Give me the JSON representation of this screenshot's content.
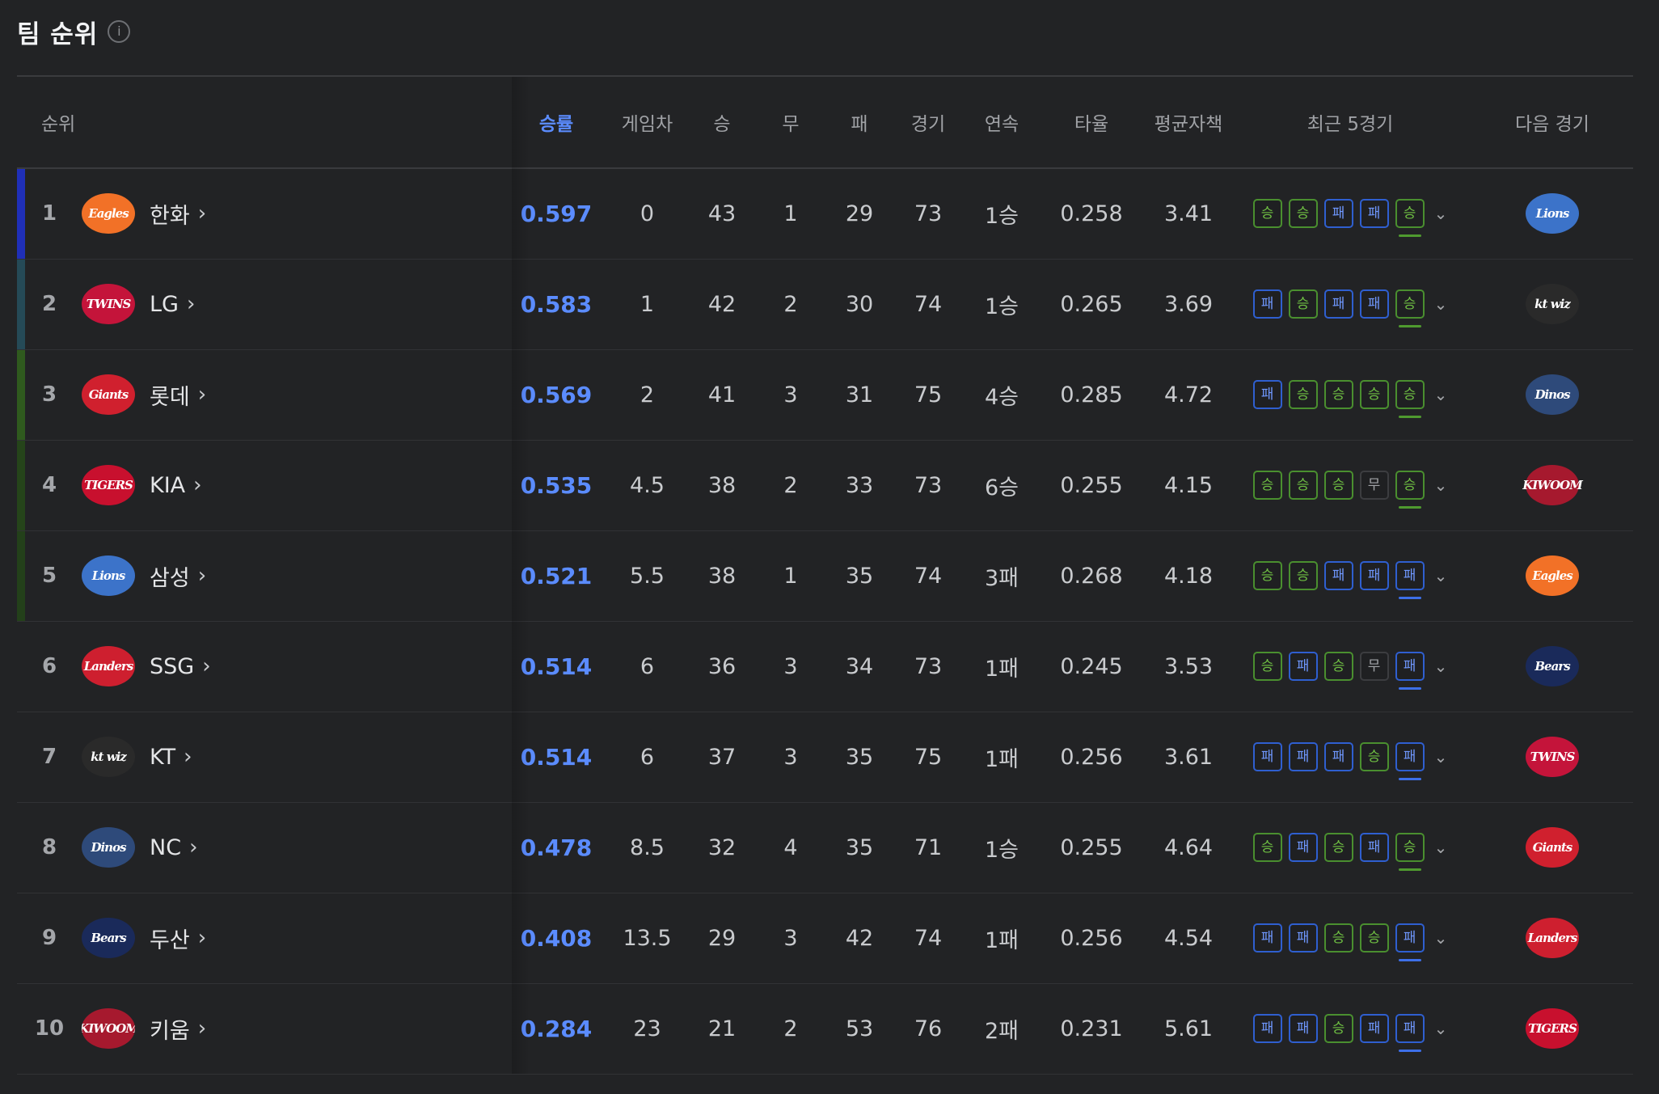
{
  "header": {
    "title": "팀 순위",
    "info_icon": "i"
  },
  "columns": [
    "순위",
    "승률",
    "게임차",
    "승",
    "무",
    "패",
    "경기",
    "연속",
    "타율",
    "평균자책",
    "최근 5경기",
    "다음 경기"
  ],
  "teams": [
    {
      "rank": "1",
      "name": "한화",
      "logo": "Eagles",
      "logo_color": "#f27127",
      "bar_color": "#1f2fb8",
      "wpct": "0.597",
      "gb": "0",
      "w": "43",
      "d": "1",
      "l": "29",
      "g": "73",
      "streak": "1승",
      "avg": "0.258",
      "era": "3.41",
      "recent": [
        "승",
        "승",
        "패",
        "패",
        "승"
      ],
      "next": "Lions",
      "next_color": "#3c73c9"
    },
    {
      "rank": "2",
      "name": "LG",
      "logo": "TWINS",
      "logo_color": "#c4143a",
      "bar_color": "#254a57",
      "wpct": "0.583",
      "gb": "1",
      "w": "42",
      "d": "2",
      "l": "30",
      "g": "74",
      "streak": "1승",
      "avg": "0.265",
      "era": "3.69",
      "recent": [
        "패",
        "승",
        "패",
        "패",
        "승"
      ],
      "next": "kt wiz",
      "next_color": "#2a2a2a"
    },
    {
      "rank": "3",
      "name": "롯데",
      "logo": "Giants",
      "logo_color": "#d0202e",
      "bar_color": "#2f5a1e",
      "wpct": "0.569",
      "gb": "2",
      "w": "41",
      "d": "3",
      "l": "31",
      "g": "75",
      "streak": "4승",
      "avg": "0.285",
      "era": "4.72",
      "recent": [
        "패",
        "승",
        "승",
        "승",
        "승"
      ],
      "next": "Dinos",
      "next_color": "#2e4a7a"
    },
    {
      "rank": "4",
      "name": "KIA",
      "logo": "TIGERS",
      "logo_color": "#c8102e",
      "bar_color": "#25441a",
      "wpct": "0.535",
      "gb": "4.5",
      "w": "38",
      "d": "2",
      "l": "33",
      "g": "73",
      "streak": "6승",
      "avg": "0.255",
      "era": "4.15",
      "recent": [
        "승",
        "승",
        "승",
        "무",
        "승"
      ],
      "next": "KIWOOM",
      "next_color": "#a6192e"
    },
    {
      "rank": "5",
      "name": "삼성",
      "logo": "Lions",
      "logo_color": "#3c73c9",
      "bar_color": "#23401a",
      "wpct": "0.521",
      "gb": "5.5",
      "w": "38",
      "d": "1",
      "l": "35",
      "g": "74",
      "streak": "3패",
      "avg": "0.268",
      "era": "4.18",
      "recent": [
        "승",
        "승",
        "패",
        "패",
        "패"
      ],
      "next": "Eagles",
      "next_color": "#f27127"
    },
    {
      "rank": "6",
      "name": "SSG",
      "logo": "Landers",
      "logo_color": "#ce1f2f",
      "bar_color": "",
      "wpct": "0.514",
      "gb": "6",
      "w": "36",
      "d": "3",
      "l": "34",
      "g": "73",
      "streak": "1패",
      "avg": "0.245",
      "era": "3.53",
      "recent": [
        "승",
        "패",
        "승",
        "무",
        "패"
      ],
      "next": "Bears",
      "next_color": "#1a2a5a"
    },
    {
      "rank": "7",
      "name": "KT",
      "logo": "kt wiz",
      "logo_color": "#2a2a2a",
      "bar_color": "",
      "wpct": "0.514",
      "gb": "6",
      "w": "37",
      "d": "3",
      "l": "35",
      "g": "75",
      "streak": "1패",
      "avg": "0.256",
      "era": "3.61",
      "recent": [
        "패",
        "패",
        "패",
        "승",
        "패"
      ],
      "next": "TWINS",
      "next_color": "#c4143a"
    },
    {
      "rank": "8",
      "name": "NC",
      "logo": "Dinos",
      "logo_color": "#2e4a7a",
      "bar_color": "",
      "wpct": "0.478",
      "gb": "8.5",
      "w": "32",
      "d": "4",
      "l": "35",
      "g": "71",
      "streak": "1승",
      "avg": "0.255",
      "era": "4.64",
      "recent": [
        "승",
        "패",
        "승",
        "패",
        "승"
      ],
      "next": "Giants",
      "next_color": "#d0202e"
    },
    {
      "rank": "9",
      "name": "두산",
      "logo": "Bears",
      "logo_color": "#1a2a5a",
      "bar_color": "",
      "wpct": "0.408",
      "gb": "13.5",
      "w": "29",
      "d": "3",
      "l": "42",
      "g": "74",
      "streak": "1패",
      "avg": "0.256",
      "era": "4.54",
      "recent": [
        "패",
        "패",
        "승",
        "승",
        "패"
      ],
      "next": "Landers",
      "next_color": "#ce1f2f"
    },
    {
      "rank": "10",
      "name": "키움",
      "logo": "KIWOOM",
      "logo_color": "#a6192e",
      "bar_color": "",
      "wpct": "0.284",
      "gb": "23",
      "w": "21",
      "d": "2",
      "l": "53",
      "g": "76",
      "streak": "2패",
      "avg": "0.231",
      "era": "5.61",
      "recent": [
        "패",
        "패",
        "승",
        "패",
        "패"
      ],
      "next": "TIGERS",
      "next_color": "#c8102e"
    }
  ],
  "ui": {
    "chevron": "›",
    "expand": "⌄"
  }
}
